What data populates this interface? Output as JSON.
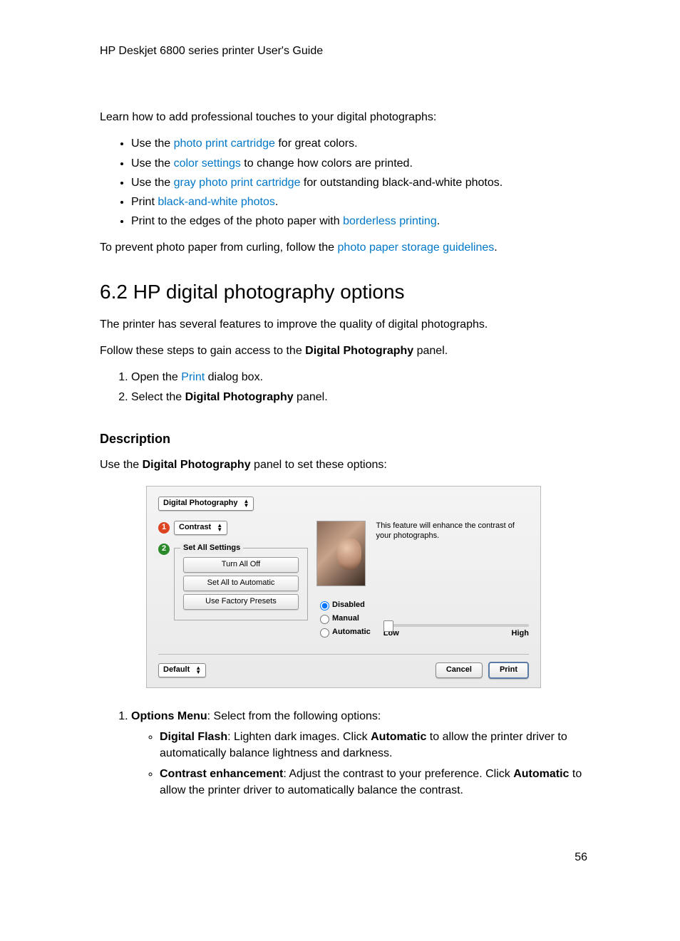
{
  "header": "HP Deskjet 6800 series printer User's Guide",
  "intro": "Learn how to add professional touches to your digital photographs:",
  "bullets": {
    "b1a": "Use the ",
    "b1link": "photo print cartridge",
    "b1b": " for great colors.",
    "b2a": "Use the ",
    "b2link": "color settings",
    "b2b": " to change how colors are printed.",
    "b3a": "Use the ",
    "b3link": "gray photo print cartridge",
    "b3b": " for outstanding black-and-white photos.",
    "b4a": "Print ",
    "b4link": "black-and-white photos",
    "b4b": ".",
    "b5a": "Print to the edges of the photo paper with ",
    "b5link": "borderless printing",
    "b5b": "."
  },
  "prevent_a": "To prevent photo paper from curling, follow the ",
  "prevent_link": "photo paper storage guidelines",
  "prevent_b": ".",
  "section_title": "6.2  HP digital photography options",
  "p1": "The printer has several features to improve the quality of digital photographs.",
  "p2a": "Follow these steps to gain access to the ",
  "p2bold": "Digital Photography",
  "p2b": " panel.",
  "step1a": "Open the ",
  "step1link": "Print",
  "step1b": " dialog box.",
  "step2a": "Select the ",
  "step2bold": "Digital Photography",
  "step2b": " panel.",
  "desc_heading": "Description",
  "desc_intro_a": "Use the ",
  "desc_intro_bold": "Digital Photography",
  "desc_intro_b": " panel to set these options:",
  "dialog": {
    "panel_combo": "Digital Photography",
    "callout1": "1",
    "options_combo": "Contrast",
    "callout2": "2",
    "fieldset_legend": "Set All Settings",
    "btn_turn_off": "Turn All Off",
    "btn_set_auto": "Set All to Automatic",
    "btn_factory": "Use Factory Presets",
    "feature_desc": "This feature will enhance the contrast of your photographs.",
    "radio_disabled": "Disabled",
    "radio_manual": "Manual",
    "radio_automatic": "Automatic",
    "slider_low": "Low",
    "slider_high": "High",
    "preset_combo": "Default",
    "cancel": "Cancel",
    "print": "Print"
  },
  "opt1_a": "",
  "opt1_bold": "Options Menu",
  "opt1_b": ": Select from the following options:",
  "sub_df_t": "Digital Flash",
  "sub_df_a": ": Lighten dark images. Click ",
  "sub_df_bold": "Automatic",
  "sub_df_b": " to allow the printer driver to automatically balance lightness and darkness.",
  "sub_ce_t": "Contrast enhancement",
  "sub_ce_a": ": Adjust the contrast to your preference. Click ",
  "sub_ce_bold": "Automatic",
  "sub_ce_b": " to allow the printer driver to automatically balance the contrast.",
  "page_number": "56"
}
